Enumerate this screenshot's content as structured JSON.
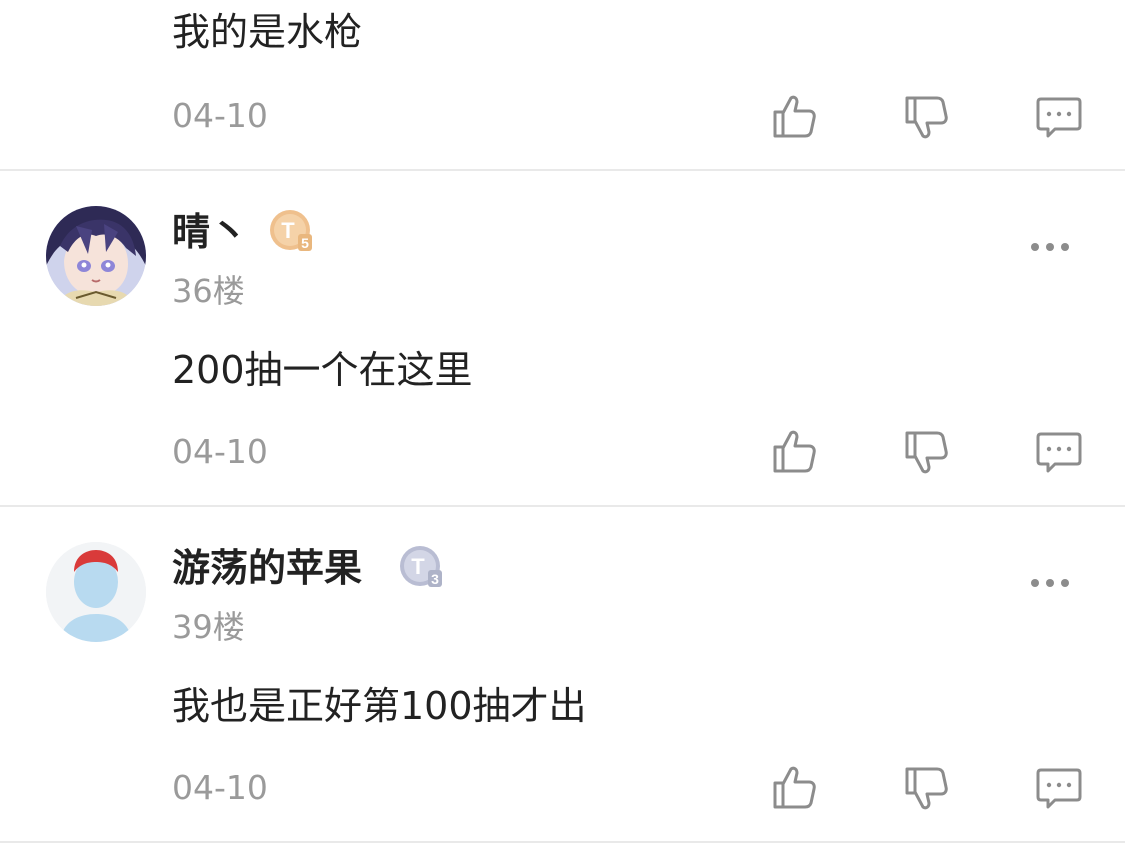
{
  "comments": [
    {
      "content": "我的是水枪",
      "date": "04-10"
    },
    {
      "username": "晴丶",
      "badge_level": "5",
      "floor": "36楼",
      "content": "200抽一个在这里",
      "date": "04-10"
    },
    {
      "username": "游荡的苹果",
      "badge_level": "3",
      "floor": "39楼",
      "content": "我也是正好第100抽才出",
      "date": "04-10"
    }
  ],
  "colors": {
    "text_primary": "#222222",
    "text_secondary": "#9a9a9a",
    "icon": "#8c8c8c",
    "divider": "#e9e9e9",
    "badge_gold": "#e9b77e",
    "badge_silver": "#aeb3c8"
  },
  "icons": {
    "like": "thumbs-up-icon",
    "dislike": "thumbs-down-icon",
    "reply": "comment-icon",
    "more": "more-dots-icon"
  }
}
